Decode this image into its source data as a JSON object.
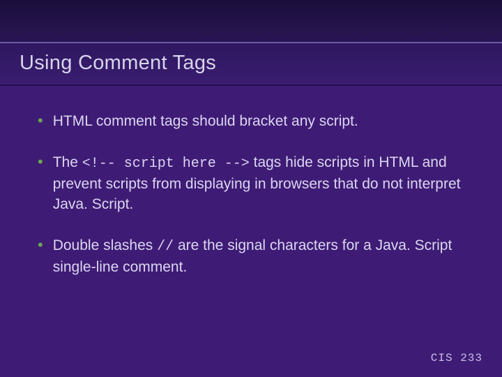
{
  "slide": {
    "title": "Using Comment Tags",
    "bullets": [
      {
        "segments": [
          {
            "text": "HTML comment tags should bracket any script.",
            "code": false
          }
        ]
      },
      {
        "segments": [
          {
            "text": "The ",
            "code": false
          },
          {
            "text": "<!-- script here -->",
            "code": true
          },
          {
            "text": " tags hide scripts in HTML and prevent scripts from displaying in browsers that do not interpret Java. Script.",
            "code": false
          }
        ]
      },
      {
        "segments": [
          {
            "text": "Double slashes ",
            "code": false
          },
          {
            "text": "//",
            "code": true
          },
          {
            "text": " are the signal characters for a Java. Script single-line comment.",
            "code": false
          }
        ]
      }
    ],
    "footer": "CIS 233"
  }
}
